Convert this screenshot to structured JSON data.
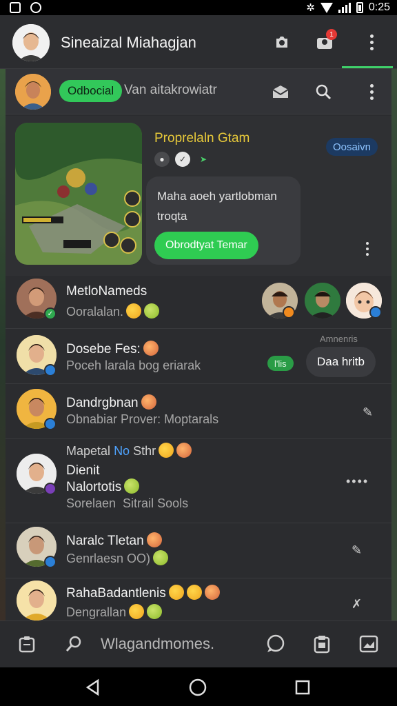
{
  "status_bar": {
    "time": "0:25"
  },
  "app_bar": {
    "title": "Sineaizal Miahagjan",
    "notification_count": "1"
  },
  "chat_bar": {
    "pill_label": "Odbocial",
    "subtitle": "Van aitakrowiatr"
  },
  "game_card": {
    "title": "Proprelaln Gtam",
    "tag": "Oosaivn",
    "bubble_text": "Maha aoeh yartlobman troqta",
    "cta_label": "Obrodtyat Temar"
  },
  "conversations": [
    {
      "name": "MetloNameds",
      "message": "Ooralalan."
    },
    {
      "name": "Dosebe Fes:",
      "message": "Poceh larala bog eriarak",
      "tag": "l'lis"
    },
    {
      "name": "Dandrgbnan",
      "message": "Obnabiar Prover: Moptarals"
    },
    {
      "header": "Mapetal",
      "header_highlight": "No",
      "header_tail": "Sthr",
      "name_line1": "Dienit",
      "name_line2": "Nalortotis",
      "message": "Sorelaen  Sitrail Sools"
    },
    {
      "name": "Naralc Tletan",
      "message": "Genrlaesn OO)"
    },
    {
      "name": "RahaBadantlenis",
      "message": "Dengrallan"
    }
  ],
  "tooltip": {
    "label": "Amnenris",
    "text": "Daa hritb"
  },
  "composer": {
    "placeholder": "Wlagandmomes."
  },
  "colors": {
    "accent_green": "#32c85a",
    "dark_bg": "#2b2c2f",
    "badge_red": "#e53935",
    "link_blue": "#1c3a62"
  }
}
